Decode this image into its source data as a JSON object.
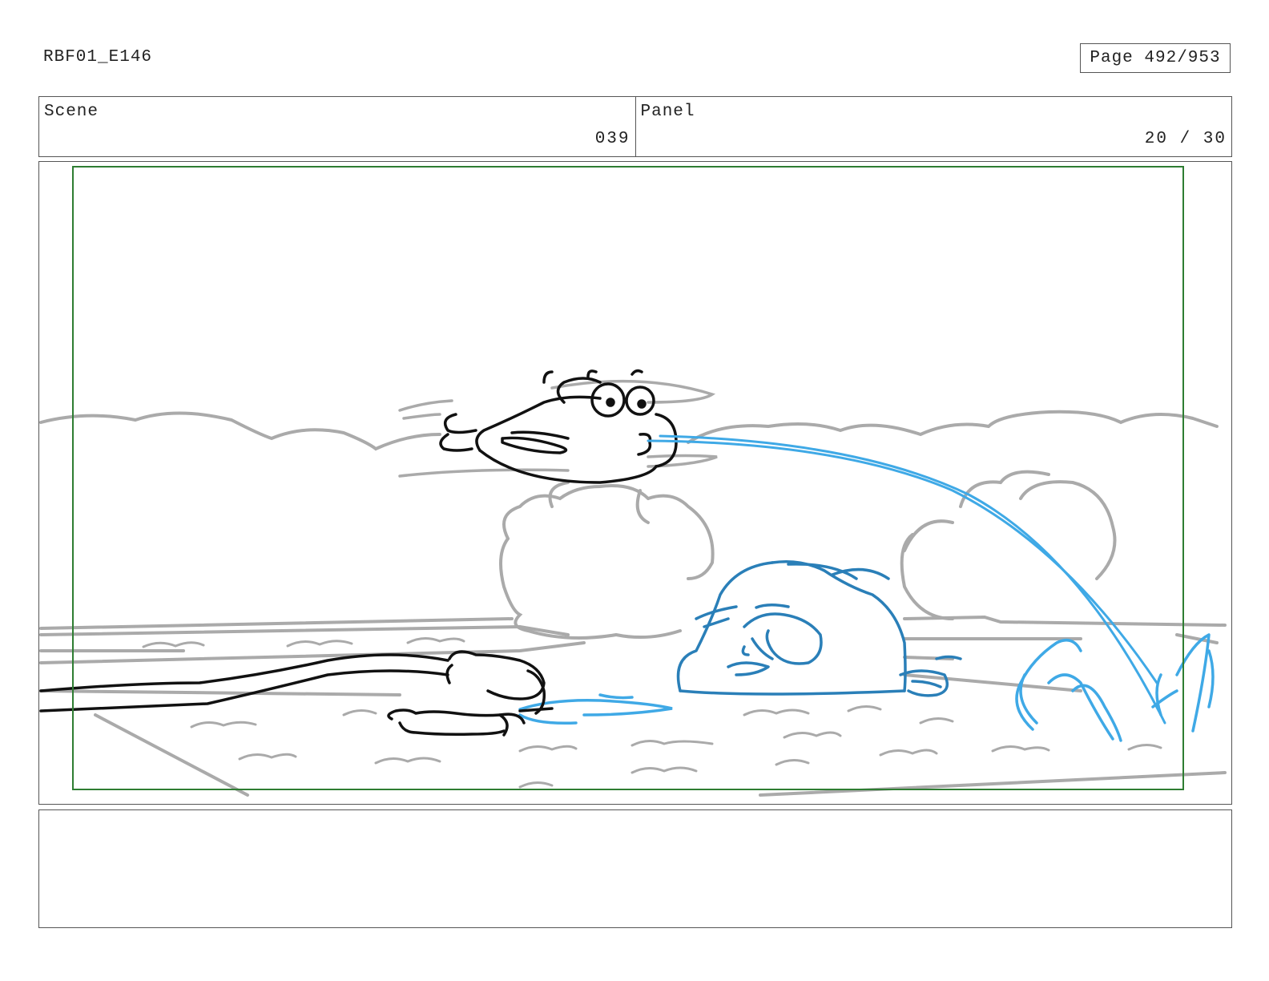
{
  "header": {
    "doc_id": "RBF01_E146",
    "page_label": "Page 492/953"
  },
  "info": {
    "scene_label": "Scene",
    "scene_value": "039",
    "panel_label": "Panel",
    "panel_value": "20 / 30"
  },
  "notes": {
    "text": ""
  },
  "colors": {
    "safe_frame": "#2e7d32",
    "background_lines": "#aaaaaa",
    "character_black": "#111111",
    "character_blue": "#2a7fb8",
    "water_blue": "#3fa9e6"
  }
}
